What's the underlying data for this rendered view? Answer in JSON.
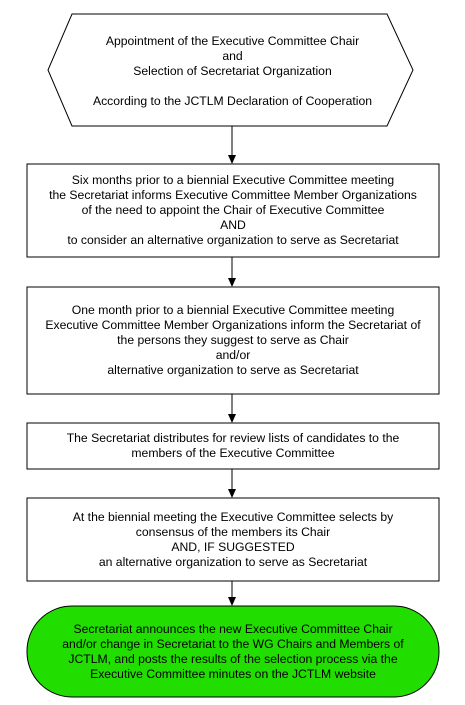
{
  "flowchart": {
    "start": {
      "lines": [
        "Appointment of the Executive Committee Chair",
        "and",
        "Selection of Secretariat Organization",
        "According to the JCTLM Declaration of Cooperation"
      ]
    },
    "steps": [
      {
        "lines": [
          "Six months prior to a biennial Executive Committee meeting",
          "the Secretariat informs Executive Committee Member Organizations",
          "of the need to appoint the Chair of Executive Committee",
          "AND",
          "to consider an alternative organization to serve as Secretariat"
        ]
      },
      {
        "lines": [
          "One month prior to a biennial Executive Committee meeting",
          "Executive Committee Member Organizations inform the Secretariat of",
          "the persons they suggest to serve as Chair",
          "and/or",
          "alternative organization to serve as Secretariat"
        ]
      },
      {
        "lines": [
          "The Secretariat distributes for review lists of candidates to the",
          "members of the Executive Committee"
        ]
      },
      {
        "lines": [
          "At the biennial meeting the Executive Committee selects by",
          "consensus of the members its Chair",
          "AND, IF SUGGESTED",
          "an alternative organization to serve as Secretariat"
        ]
      }
    ],
    "end": {
      "fill_color": "#22dd00",
      "lines": [
        "Secretariat announces the new Executive Committee Chair",
        "and/or change in Secretariat to the WG Chairs and Members of",
        "JCTLM, and posts the results of the selection process via the",
        "Executive Committee minutes on the JCTLM website"
      ]
    }
  }
}
